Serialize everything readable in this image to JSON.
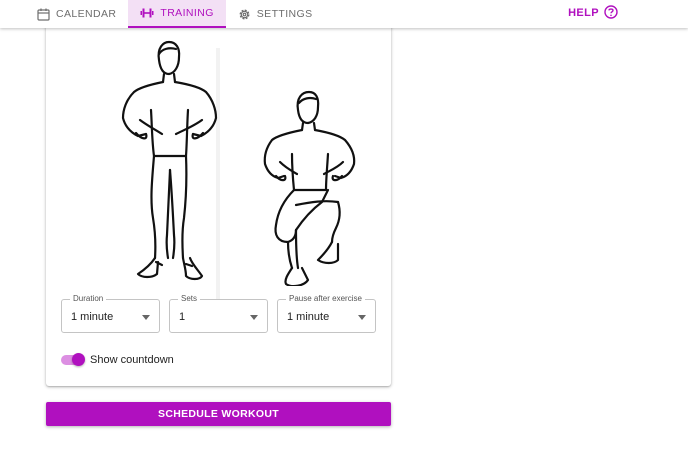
{
  "nav": {
    "tabs": [
      {
        "label": "CALENDAR",
        "icon": "calendar-icon",
        "active": false
      },
      {
        "label": "TRAINING",
        "icon": "dumbbell-icon",
        "active": true
      },
      {
        "label": "SETTINGS",
        "icon": "gear-icon",
        "active": false
      }
    ],
    "help_label": "HELP",
    "help_icon": "question-circle-icon"
  },
  "exercise": {
    "images": [
      "standing-hands-on-hips",
      "knee-raise-hands-on-hips"
    ]
  },
  "options": {
    "duration": {
      "legend": "Duration",
      "value": "1 minute"
    },
    "sets": {
      "legend": "Sets",
      "value": "1"
    },
    "pause": {
      "legend": "Pause after exercise",
      "value": "1 minute"
    }
  },
  "countdown": {
    "label": "Show countdown",
    "enabled": true
  },
  "actions": {
    "schedule_label": "SCHEDULE WORKOUT"
  },
  "colors": {
    "accent": "#b010bf",
    "accent_light": "#f3e0f5",
    "toggle_track": "#dc8fe2"
  }
}
